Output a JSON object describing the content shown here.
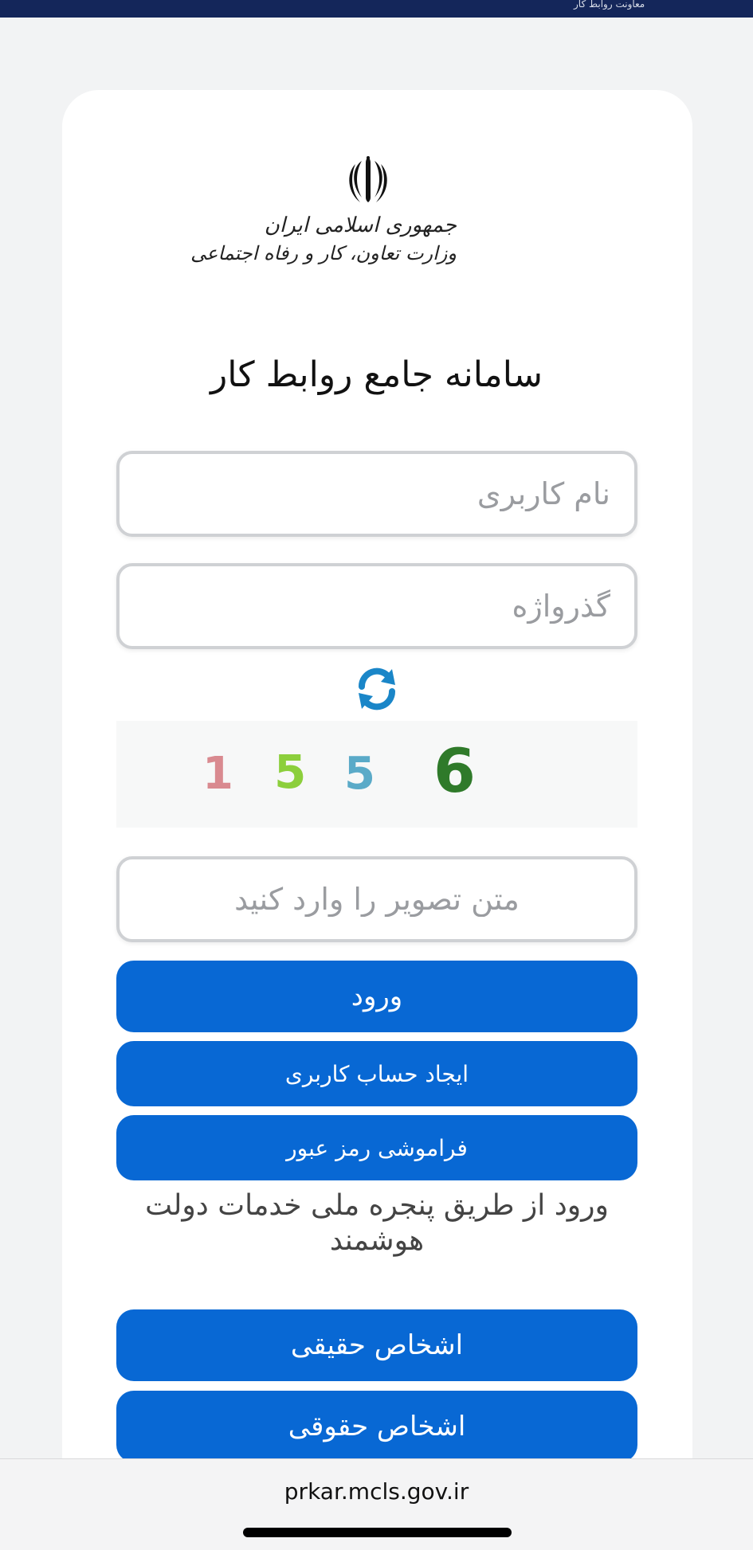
{
  "top_bar": {
    "text": "معاونت روابط کار"
  },
  "logo": {
    "line1": "جمهوری اسلامی ایران",
    "line2": "وزارت تعاون، کار و رفاه اجتماعی"
  },
  "title": "سامانه جامع روابط کار",
  "form": {
    "username_placeholder": "نام کاربری",
    "password_placeholder": "گذرواژه",
    "captcha_placeholder": "متن تصویر را وارد کنید",
    "captcha_digits": [
      "1",
      "5",
      "5",
      "6"
    ]
  },
  "buttons": {
    "login": "ورود",
    "create_account": "ایجاد حساب کاربری",
    "forgot_password": "فراموشی رمز عبور",
    "individuals": "اشخاص حقیقی",
    "legal_entities": "اشخاص حقوقی"
  },
  "gov_login_text": "ورود از طریق پنجره ملی خدمات دولت هوشمند",
  "browser": {
    "url": "prkar.mcls.gov.ir"
  },
  "colors": {
    "primary": "#0868d4",
    "refresh_icon": "#1a86c8",
    "top_bar": "#14265a"
  }
}
